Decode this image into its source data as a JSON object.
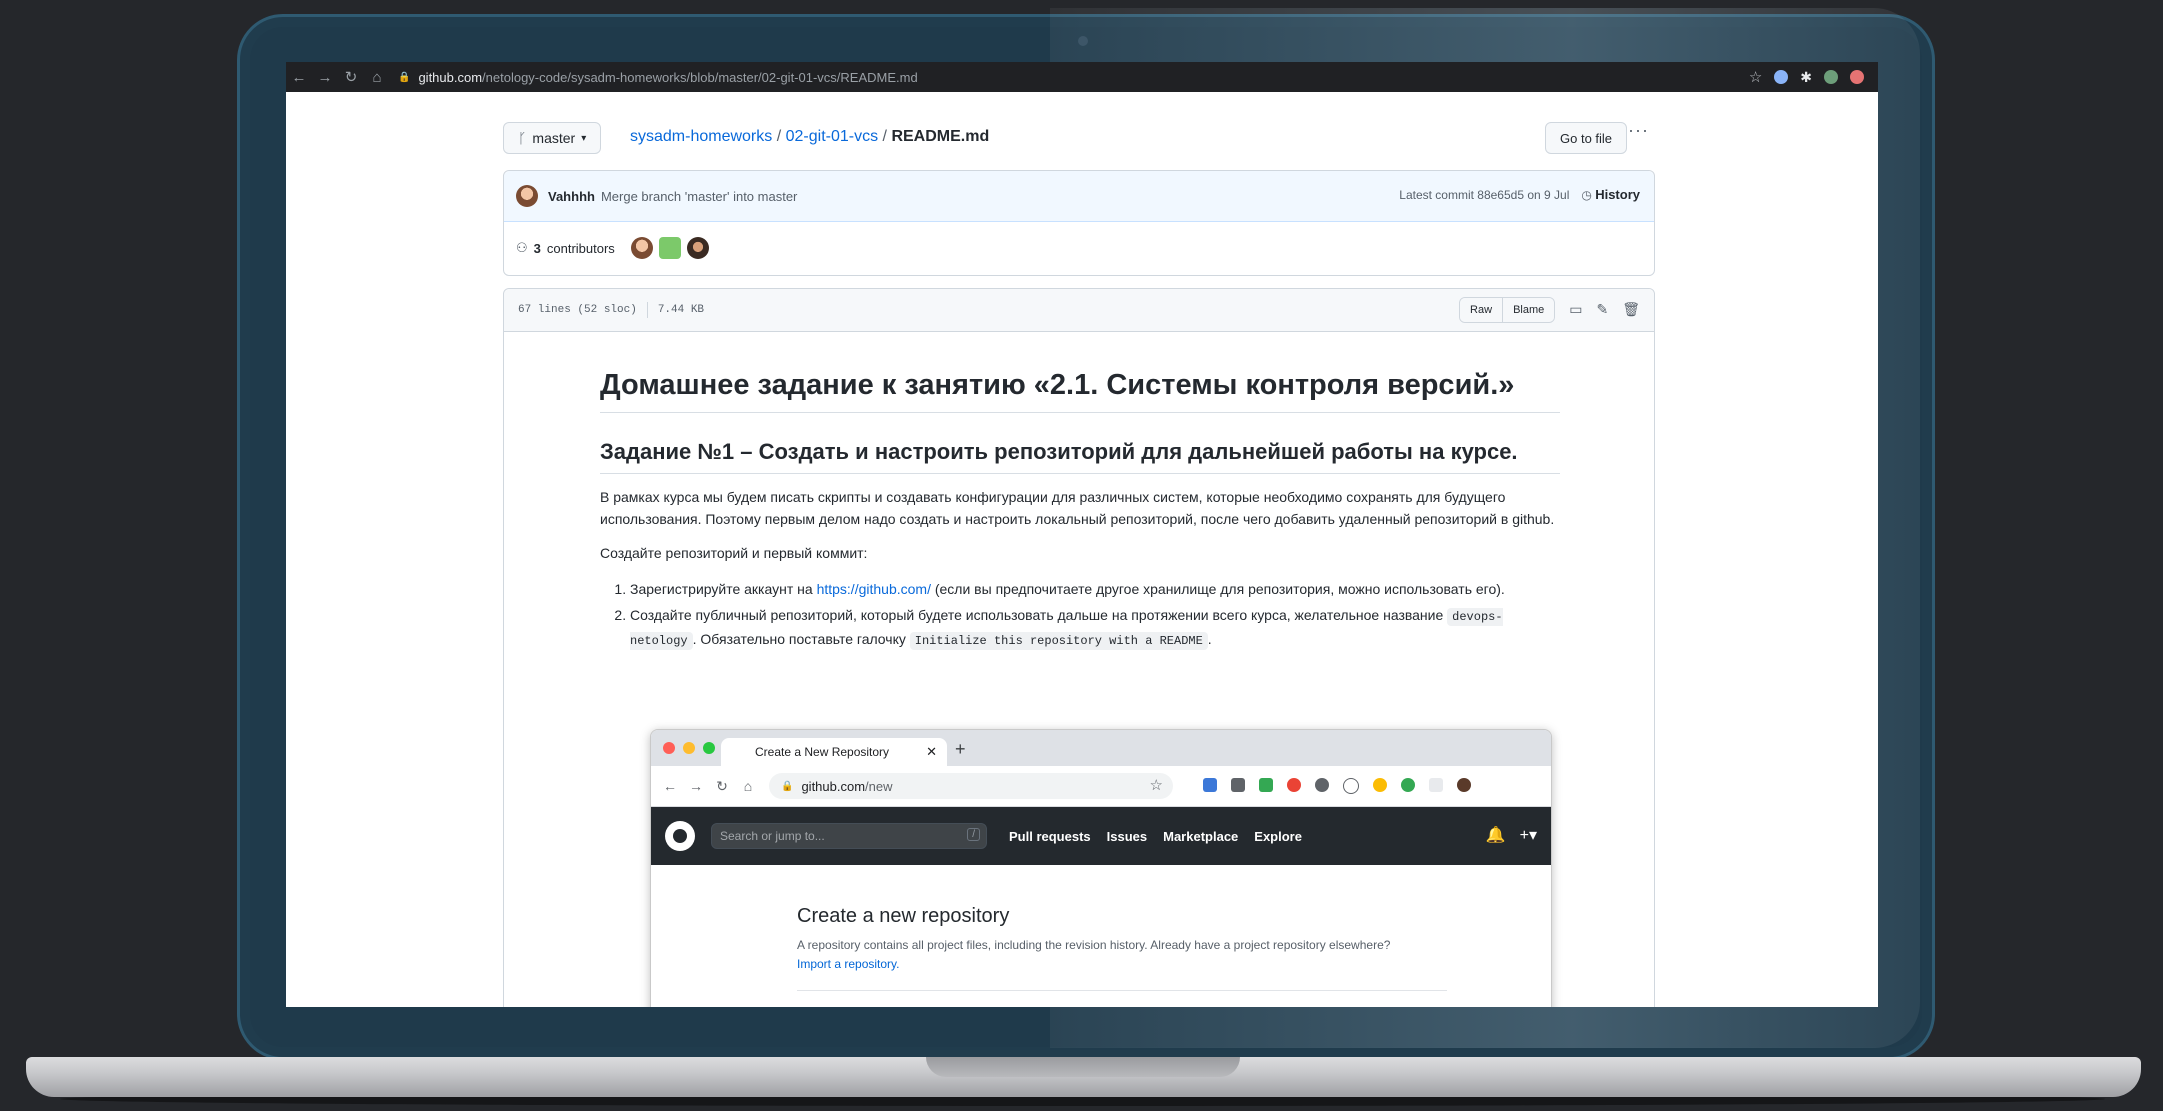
{
  "browser": {
    "url_host": "github.com",
    "url_path": "/netology-code/sysadm-homeworks/blob/master/02-git-01-vcs/README.md"
  },
  "repo": {
    "branch": "master",
    "owner_repo": "sysadm-homeworks",
    "folder": "02-git-01-vcs",
    "file": "README.md",
    "goto_file": "Go to file",
    "more": "···"
  },
  "commit": {
    "user": "Vahhhh",
    "message": "Merge branch 'master' into master",
    "latest": "Latest commit 88e65d5 on 9 Jul",
    "history": "History",
    "contributors_count": "3",
    "contributors_label": "contributors"
  },
  "file": {
    "lines": "67 lines (52 sloc)",
    "size": "7.44 KB",
    "raw": "Raw",
    "blame": "Blame"
  },
  "readme": {
    "h1": "Домашнее задание к занятию «2.1. Системы контроля версий.»",
    "h2": "Задание №1 – Создать и настроить репозиторий для дальнейшей работы на курсе.",
    "p1": "В рамках курса мы будем писать скрипты и создавать конфигурации для различных систем, которые необходимо сохранять для будущего использования. Поэтому первым делом надо создать и настроить локальный репозиторий, после чего добавить удаленный репозиторий в github.",
    "p2": "Создайте репозиторий и первый коммит:",
    "li1_a": "Зарегистрируйте аккаунт на",
    "li1_link": "https://github.com/",
    "li1_b": "(если вы предпочитаете другое хранилище для репозитория, можно использовать его).",
    "li2_a": "Создайте публичный репозиторий, который будете использовать дальше на протяжении всего курса, желательное название",
    "li2_code1": "devops-netology",
    "li2_b": ". Обязательно поставьте галочку",
    "li2_code2": "Initialize this repository with a README",
    "li2_c": "."
  },
  "embedded": {
    "tab_title": "Create a New Repository",
    "url_host": "github.com",
    "url_path": "/new",
    "search_placeholder": "Search or jump to...",
    "search_key": "/",
    "nav": [
      "Pull requests",
      "Issues",
      "Marketplace",
      "Explore"
    ],
    "title": "Create a new repository",
    "desc": "A repository contains all project files, including the revision history. Already have a project repository elsewhere?",
    "import_link": "Import a repository."
  }
}
